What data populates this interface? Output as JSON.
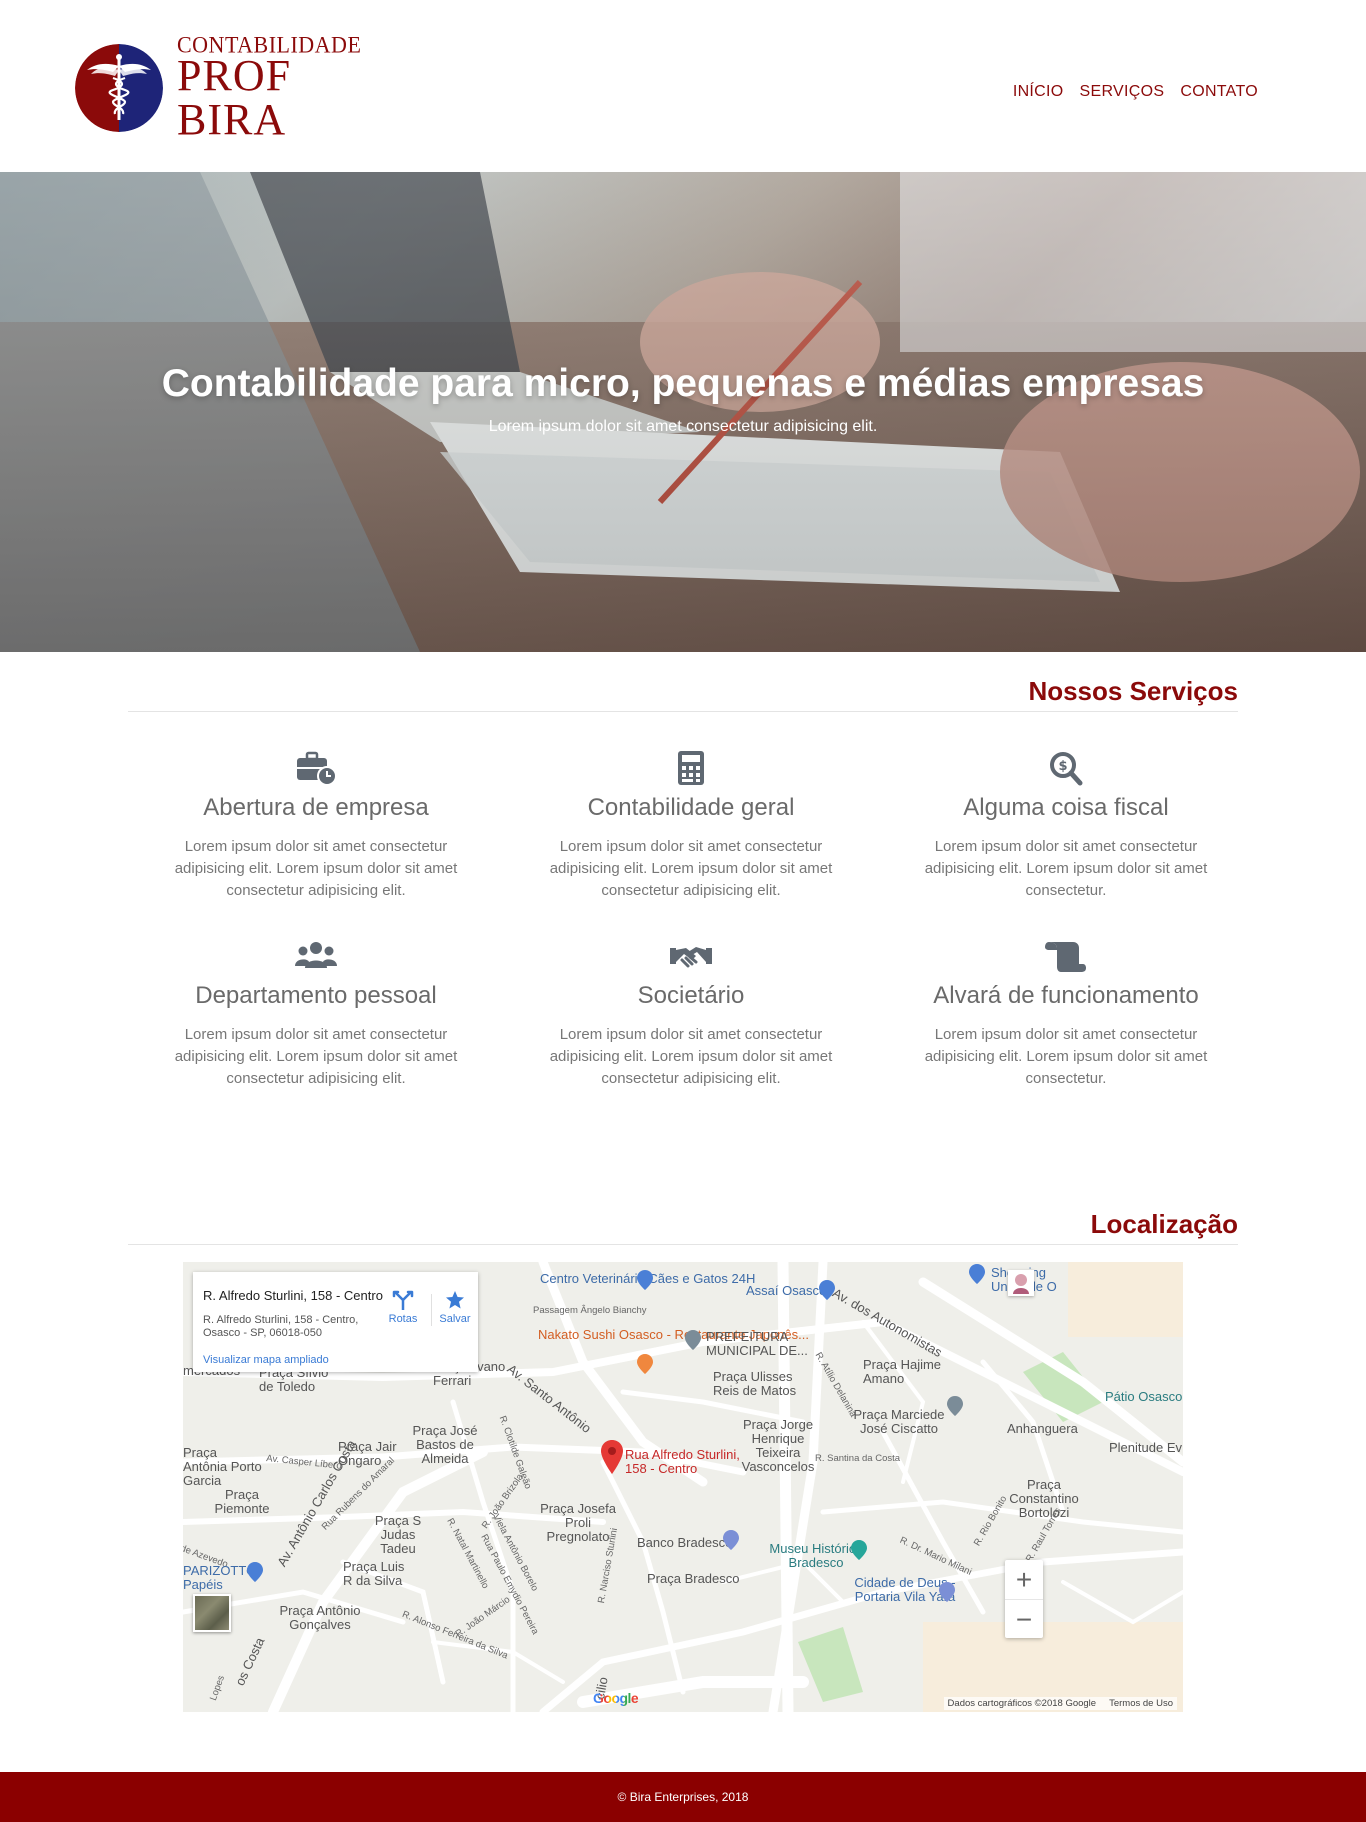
{
  "brand": {
    "logo_line1": "CONTABILIDADE",
    "logo_line2": "PROF BIRA",
    "colors": {
      "primary": "#8b0a0a",
      "seal_blue": "#1e2478",
      "footer": "#8b0000"
    }
  },
  "nav": {
    "items": [
      "INÍCIO",
      "SERVIÇOS",
      "CONTATO"
    ]
  },
  "hero": {
    "title": "Contabilidade para micro, pequenas e médias empresas",
    "subtitle": "Lorem ipsum dolor sit amet consectetur adipisicing elit."
  },
  "services": {
    "title": "Nossos Serviços",
    "items": [
      {
        "icon": "briefcase-clock-icon",
        "title": "Abertura de empresa",
        "text": "Lorem ipsum dolor sit amet consectetur adipisicing elit. Lorem ipsum dolor sit amet consectetur adipisicing elit."
      },
      {
        "icon": "calculator-icon",
        "title": "Contabilidade geral",
        "text": "Lorem ipsum dolor sit amet consectetur adipisicing elit. Lorem ipsum dolor sit amet consectetur adipisicing elit."
      },
      {
        "icon": "search-dollar-icon",
        "title": "Alguma coisa fiscal",
        "text": "Lorem ipsum dolor sit amet consectetur adipisicing elit. Lorem ipsum dolor sit amet consectetur."
      },
      {
        "icon": "users-icon",
        "title": "Departamento pessoal",
        "text": "Lorem ipsum dolor sit amet consectetur adipisicing elit. Lorem ipsum dolor sit amet consectetur adipisicing elit."
      },
      {
        "icon": "handshake-icon",
        "title": "Societário",
        "text": "Lorem ipsum dolor sit amet consectetur adipisicing elit. Lorem ipsum dolor sit amet consectetur adipisicing elit."
      },
      {
        "icon": "scroll-icon",
        "title": "Alvará de funcionamento",
        "text": "Lorem ipsum dolor sit amet consectetur adipisicing elit. Lorem ipsum dolor sit amet consectetur."
      }
    ]
  },
  "location": {
    "title": "Localização",
    "card": {
      "title": "R. Alfredo Sturlini, 158 - Centro",
      "address": "R. Alfredo Sturlini, 158 - Centro, Osasco - SP, 06018-050",
      "link": "Visualizar mapa ampliado",
      "directions": "Rotas",
      "save": "Salvar"
    },
    "pin_label": "Rua Alfredo Sturlini, 158 - Centro",
    "labels": {
      "vet": "Centro Veterinário Cães e Gatos 24H",
      "passagem": "Passagem Ângelo Bianchy",
      "sushi": "Nakato Sushi Osasco - Restaurante Japonês...",
      "prefeitura": "PREFEITURA MUNICIPAL DE...",
      "assai": "Assaí Osasco",
      "autonomistas": "Av. dos Autonomistas",
      "shopping": "Shopping União de O",
      "mercados": "mercados",
      "silvio": "Praça Sílvio de Toledo",
      "ilvano": "Praça Ilvano Ferrari",
      "santo_antonio": "Av. Santo Antônio",
      "ulisses": "Praça Ulisses Reis de Matos",
      "hajime": "Praça Hajime Amano",
      "patio": "Pátio Osasco",
      "atilio": "R. Atílio Delanina",
      "clotilde": "R. Clotilde Galeão",
      "jose_bastos": "Praça José Bastos de Almeida",
      "jair": "Praça Jair Ongaro",
      "casper": "Av. Casper Líbero",
      "antonia": "Praça Antônia Porto Garcia",
      "marciede": "Praça Marciede José Ciscatto",
      "anhanguera": "Anhanguera",
      "plenitude": "Plenitude Ev",
      "jorge": "Praça Jorge Henrique Teixeira Vasconcelos",
      "santina": "R. Santina da Costa",
      "piemonte": "Praça Piemonte",
      "antonio_carlos": "Av. Antônio Carlos Costa",
      "rubens": "Rua Rubens do Amaral",
      "joao_brizola": "R. João Brizola",
      "judas": "Praça S Judas Tadeu",
      "natal": "R. Natal Martinello",
      "viela": "Viela Antônio Borelo",
      "paulo": "Rua Paulo Emydio Pereira",
      "josefa": "Praça Josefa Proli Pregnolato",
      "narciso": "R. Narciso Sturlini",
      "constantino": "Praça Constantino Bortolozi",
      "rio_bonito": "R. Rio Bonito",
      "raul": "R. Raul Torres",
      "mario": "R. Dr. Mario Milani",
      "azevedo": "de Azevedo",
      "bradesco": "Banco Bradesco",
      "museu": "Museu Histórico Bradesco",
      "parizotto": "PARIZOTTO Papéis",
      "luis": "Praça Luis R da Silva",
      "praca_bradesco": "Praça Bradesco",
      "cidade": "Cidade de Deus - Portaria Vila Yara",
      "alonso": "R. Alonso Ferreira da Silva",
      "marcio": "R. João Márcio",
      "goncalves": "Praça Antônio Gonçalves",
      "costa_bottom": "os Costa",
      "lopes": "Lopes",
      "cilio": "cilio"
    },
    "google": "Google",
    "attribution": "Dados cartográficos ©2018 Google",
    "terms": "Termos de Uso",
    "zoom_in": "+",
    "zoom_out": "−"
  },
  "footer": {
    "text": "© Bira Enterprises, 2018"
  }
}
